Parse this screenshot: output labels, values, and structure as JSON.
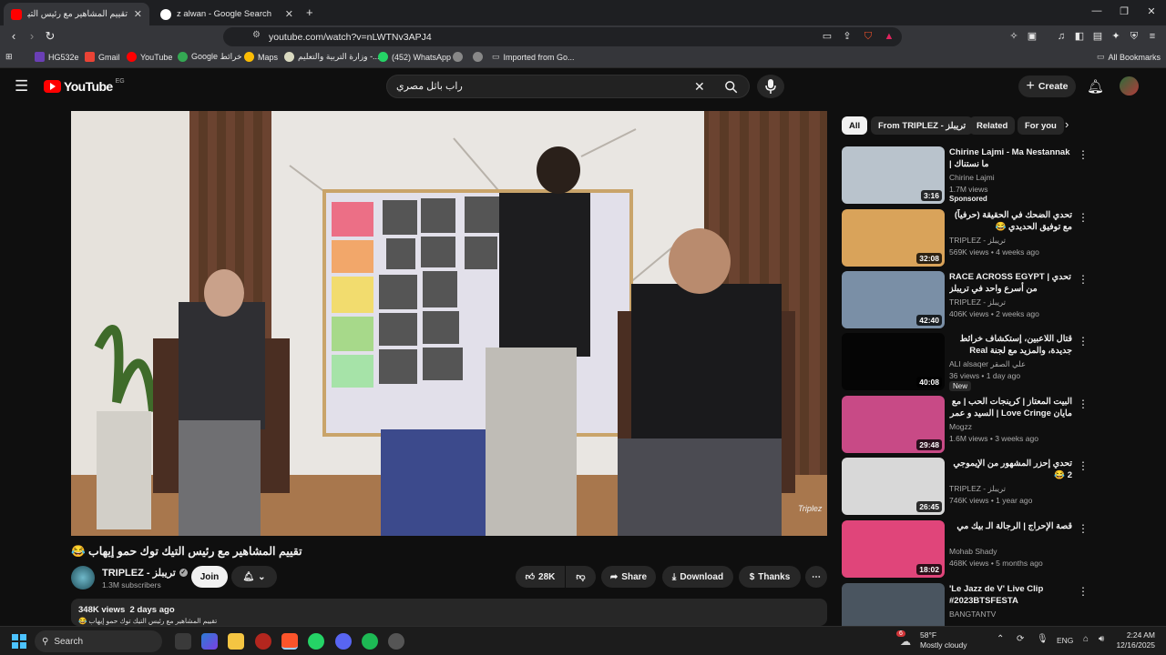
{
  "browser": {
    "tabs": [
      {
        "label": "تقييم المشاهير مع رئيس التيك توك",
        "active": true
      },
      {
        "label": "z alwan - Google Search",
        "active": false
      }
    ],
    "url": "youtube.com/watch?v=nLWTNv3APJ4",
    "bookmarks": [
      {
        "label": "HG532e"
      },
      {
        "label": "Gmail"
      },
      {
        "label": "YouTube"
      },
      {
        "label": "Google خرائط"
      },
      {
        "label": "Maps"
      },
      {
        "label": "وزارة التربية والتعليم -..."
      },
      {
        "label": "(452) WhatsApp"
      },
      {
        "label": "Imported from Go..."
      }
    ],
    "all_bookmarks": "All Bookmarks"
  },
  "youtube": {
    "logo": "YouTube",
    "country": "EG",
    "search_value": "راب باثل مصري",
    "create_label": "Create"
  },
  "video": {
    "title": "تقييم المشاهير مع رئيس التيك توك حمو إيهاب 😂",
    "channel": "TRIPLEZ - تريبلز",
    "subscribers": "1.3M subscribers",
    "join": "Join",
    "likes": "28K",
    "share": "Share",
    "download": "Download",
    "thanks": "Thanks",
    "views": "348K views",
    "age": "2 days ago",
    "desc_snippet": "تقييم المشاهير مع رئيس التيك توك حمو إيهاب 😂",
    "watermark": "Triplez"
  },
  "chips": [
    "All",
    "From TRIPLEZ - تريبلز",
    "Related",
    "For you"
  ],
  "recommendations": [
    {
      "title": "Chirine Lajmi - Ma Nestannak | ما نستناك",
      "channel": "Chirine Lajmi",
      "meta": "1.7M views",
      "badge": "Sponsored",
      "duration": "3:16",
      "thumb": "#b9c3cc"
    },
    {
      "title": "تحدي الضحك في الحقيقة (حرفياً) مع توفيق الحديدي 😂",
      "channel": "TRIPLEZ - تريبلز",
      "meta": "569K views • 4 weeks ago",
      "badge": "",
      "duration": "32:08",
      "thumb": "#d9a35a"
    },
    {
      "title": "RACE ACROSS EGYPT | تحدي من أسرع واحد في تريبلز",
      "channel": "TRIPLEZ - تريبلز",
      "meta": "406K views • 2 weeks ago",
      "badge": "",
      "duration": "42:40",
      "thumb": "#7a8fa6"
    },
    {
      "title": "قتال اللاعبين، إستكشاف خرائط جديدة، والمزيد مع لجنة Real world- مع علي ...",
      "channel": "ALI alsaqer علي الصقر",
      "meta": "36 views • 1 day ago",
      "badge": "New",
      "duration": "40:08",
      "thumb": "#050505"
    },
    {
      "title": "البيت المعتاز | كرينجات الحب | مع مايان Love Cringe | السيد و عمر رزيق",
      "channel": "Mogzz",
      "meta": "1.6M views • 3 weeks ago",
      "badge": "",
      "duration": "29:48",
      "thumb": "#c84a86"
    },
    {
      "title": "تحدي إحزر المشهور من الإيموجي 2 😂",
      "channel": "TRIPLEZ - تريبلز",
      "meta": "746K views • 1 year ago",
      "badge": "",
      "duration": "26:45",
      "thumb": "#d8d8d8"
    },
    {
      "title": "قصة الإحراج | الرجالة الـ بيك مي",
      "channel": "Mohab Shady",
      "meta": "468K views • 5 months ago",
      "badge": "",
      "duration": "18:02",
      "thumb": "#e0457a"
    },
    {
      "title": "'Le Jazz de V' Live Clip #2023BTSFESTA",
      "channel": "BANGTANTV",
      "meta": "",
      "badge": "",
      "duration": "",
      "thumb": "#4a5560"
    }
  ],
  "taskbar": {
    "search": "Search",
    "weather_temp": "58°F",
    "weather_desc": "Mostly cloudy",
    "lang": "ENG",
    "time": "2:24 AM",
    "date": "12/16/2025",
    "weather_badge": "6"
  }
}
